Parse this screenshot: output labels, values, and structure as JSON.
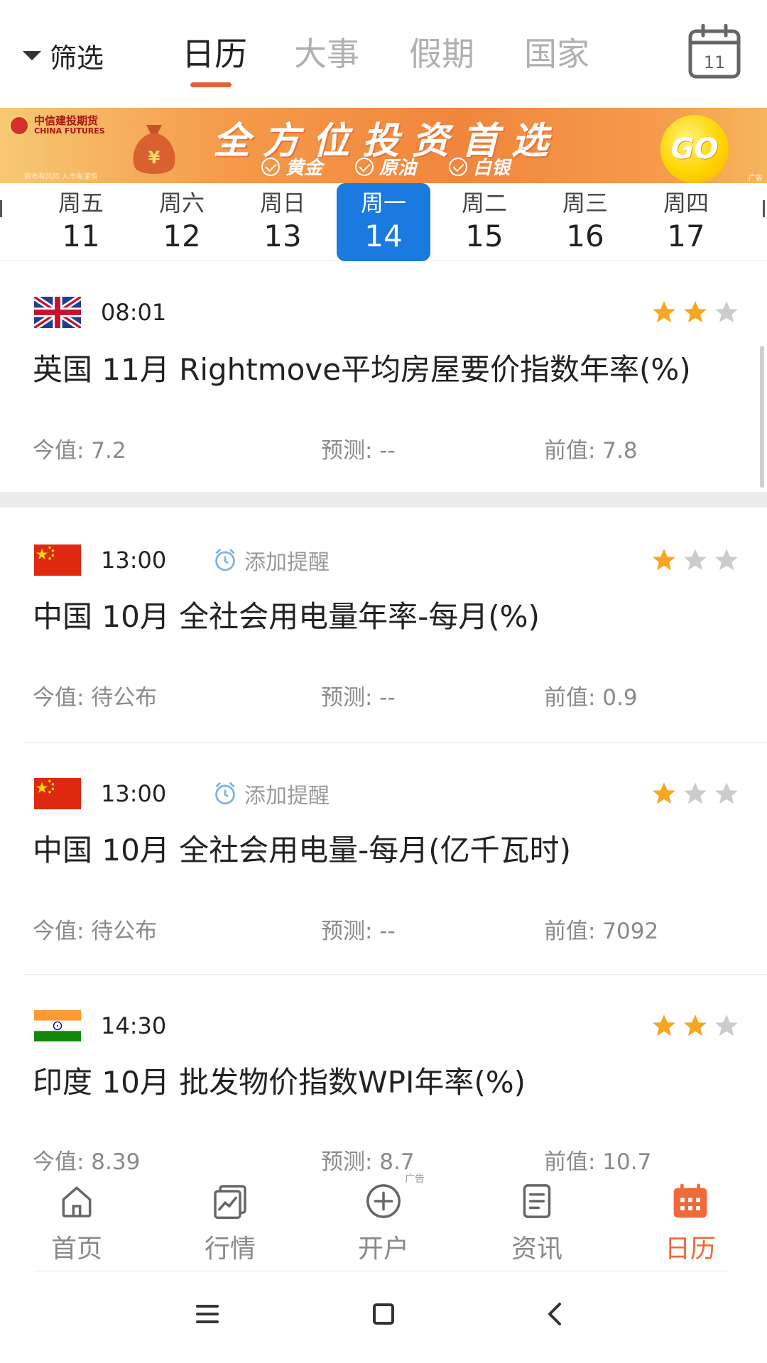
{
  "header": {
    "filter_label": "筛选",
    "tabs": [
      {
        "label": "日历",
        "active": true
      },
      {
        "label": "大事",
        "active": false
      },
      {
        "label": "假期",
        "active": false
      },
      {
        "label": "国家",
        "active": false
      }
    ],
    "calendar_icon_day": "11",
    "accent_color": "#e0623c"
  },
  "banner": {
    "brand_cn": "中信建投期货",
    "brand_en": "CHINA FUTURES",
    "disclaimer": "期市有风险 入市需谨慎",
    "headline": "全方位投资首选",
    "items": [
      "黄金",
      "原油",
      "白银"
    ],
    "go_label": "GO",
    "ad_mark": "广告"
  },
  "week": {
    "days": [
      {
        "name": "周五",
        "num": "11",
        "active": false
      },
      {
        "name": "周六",
        "num": "12",
        "active": false
      },
      {
        "name": "周日",
        "num": "13",
        "active": false
      },
      {
        "name": "周一",
        "num": "14",
        "active": true
      },
      {
        "name": "周二",
        "num": "15",
        "active": false
      },
      {
        "name": "周三",
        "num": "16",
        "active": false
      },
      {
        "name": "周四",
        "num": "17",
        "active": false
      }
    ],
    "active_color": "#1a7ae0"
  },
  "events": [
    {
      "flag": "uk-flag",
      "time": "08:01",
      "reminder_label": "",
      "stars": 2,
      "title": "英国 11月 Rightmove平均房屋要价指数年率(%)",
      "actual": "今值: 7.2",
      "forecast": "预测: --",
      "previous": "前值: 7.8"
    },
    {
      "flag": "china-flag",
      "time": "13:00",
      "reminder_label": "添加提醒",
      "stars": 1,
      "title": "中国 10月 全社会用电量年率-每月(%)",
      "actual": "今值: 待公布",
      "forecast": "预测: --",
      "previous": "前值: 0.9"
    },
    {
      "flag": "china-flag",
      "time": "13:00",
      "reminder_label": "添加提醒",
      "stars": 1,
      "title": "中国 10月 全社会用电量-每月(亿千瓦时)",
      "actual": "今值: 待公布",
      "forecast": "预测: --",
      "previous": "前值: 7092"
    },
    {
      "flag": "india-flag",
      "time": "14:30",
      "reminder_label": "",
      "stars": 2,
      "title": "印度 10月 批发物价指数WPI年率(%)",
      "actual": "今值: 8.39",
      "forecast": "预测: 8.7",
      "previous": "前值: 10.7"
    }
  ],
  "bottom_nav": {
    "items": [
      {
        "label": "首页",
        "icon": "home-icon",
        "active": false
      },
      {
        "label": "行情",
        "icon": "chart-icon",
        "active": false
      },
      {
        "label": "开户",
        "icon": "plus-circle-icon",
        "active": false
      },
      {
        "label": "资讯",
        "icon": "news-icon",
        "active": false
      },
      {
        "label": "日历",
        "icon": "calendar-icon",
        "active": true
      }
    ],
    "ad_mark": "广告",
    "active_color": "#ef6a3a"
  },
  "star_colors": {
    "on": "#f5a623",
    "off": "#cccccc"
  }
}
